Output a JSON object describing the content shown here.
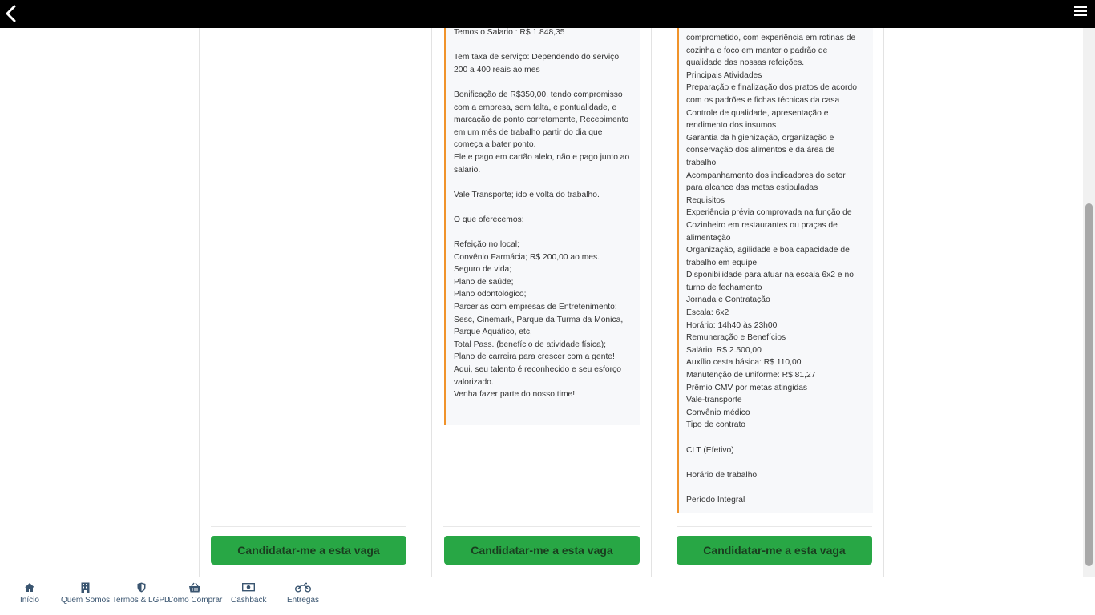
{
  "topbar": {
    "back_icon": "chevron-left-icon",
    "menu_icon": "hamburger-menu-icon"
  },
  "jobs": [
    {
      "apply_label": "Candidatar-me a esta vaga"
    },
    {
      "apply_label": "Candidatar-me a esta vaga",
      "description_lines": [
        "Temos o Salario : R$ 1.848,35",
        "",
        "Tem taxa de serviço: Dependendo do serviço",
        "200 a 400 reais ao mes",
        "",
        "Bonificação de R$350,00, tendo compromisso",
        "com a empresa, sem falta, e pontualidade, e",
        "marcação de ponto corretamente, Recebimento",
        "em um mês de trabalho partir do dia que",
        "começa a bater ponto.",
        "Ele e pago em cartão alelo, não e pago junto ao",
        "salario.",
        "",
        "Vale Transporte; ido e volta do trabalho.",
        "",
        "O que oferecemos:",
        "",
        "Refeição no local;",
        "Convênio Farmácia; R$ 200,00 ao mes.",
        "Seguro de vida;",
        "Plano de saúde;",
        "Plano odontológico;",
        "Parcerias com empresas de Entretenimento;",
        "Sesc, Cinemark, Parque da Turma da Monica,",
        "Parque Aquático, etc.",
        "Total Pass. (benefício de atividade física);",
        "Plano de carreira para crescer com a gente!",
        "Aqui, seu talento é reconhecido e seu esforço",
        "valorizado.",
        "Venha fazer parte do nosso time!"
      ]
    },
    {
      "apply_label": "Candidatar-me a esta vaga",
      "description_lines": [
        "comprometido, com experiência em rotinas de",
        "cozinha e foco em manter o padrão de",
        "qualidade das nossas refeições.",
        "Principais Atividades",
        "Preparação e finalização dos pratos de acordo",
        "com os padrões e fichas técnicas da casa",
        "Controle de qualidade, apresentação e",
        "rendimento dos insumos",
        "Garantia da higienização, organização e",
        "conservação dos alimentos e da área de",
        "trabalho",
        "Acompanhamento dos indicadores do setor",
        "para alcance das metas estipuladas",
        "Requisitos",
        "Experiência prévia comprovada na função de",
        "Cozinheiro em restaurantes ou praças de",
        "alimentação",
        "Organização, agilidade e boa capacidade de",
        "trabalho em equipe",
        "Disponibilidade para atuar na escala 6x2 e no",
        "turno de fechamento",
        "Jornada e Contratação",
        "Escala: 6x2",
        "Horário: 14h40 às 23h00",
        "Remuneração e Benefícios",
        "Salário: R$ 2.500,00",
        "Auxílio cesta básica: R$ 110,00",
        "Manutenção de uniforme: R$ 81,27",
        "Prêmio CMV por metas atingidas",
        "Vale-transporte",
        "Convênio médico",
        "Tipo de contrato",
        "",
        "CLT (Efetivo)",
        "",
        "Horário de trabalho",
        "",
        "Período Integral"
      ]
    }
  ],
  "bottom_nav": [
    {
      "label": "Início",
      "icon": "home-icon"
    },
    {
      "label": "Quem Somos",
      "icon": "building-icon"
    },
    {
      "label": "Termos & LGPD",
      "icon": "shield-icon"
    },
    {
      "label": "Como Comprar",
      "icon": "basket-icon"
    },
    {
      "label": "Cashback",
      "icon": "money-icon"
    },
    {
      "label": "Entregas",
      "icon": "motorcycle-icon"
    }
  ],
  "colors": {
    "accent_green": "#28a745",
    "border_orange": "#f0932b",
    "topbar": "#000000"
  }
}
